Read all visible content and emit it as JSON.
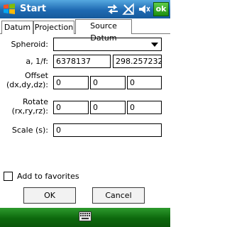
{
  "titlebar": {
    "title": "Start",
    "ok_label": "ok",
    "icons": [
      "windows-logo",
      "sync-arrows-icon",
      "signal-off-icon",
      "volume-icon"
    ]
  },
  "tabs": [
    {
      "label": "Datum",
      "active": false
    },
    {
      "label": "Projection",
      "active": false
    },
    {
      "label": "Source Datum",
      "active": true
    }
  ],
  "form": {
    "spheroid_label": "Spheroid:",
    "spheroid_value": "",
    "af_label": "a, 1/f:",
    "a_value": "6378137",
    "f_value": "298.257232",
    "offset_label_1": "Offset",
    "offset_label_2": "(dx,dy,dz):",
    "offset_values": [
      "0",
      "0",
      "0"
    ],
    "rotate_label_1": "Rotate",
    "rotate_label_2": "(rx,ry,rz):",
    "rotate_values": [
      "0",
      "0",
      "0"
    ],
    "scale_label": "Scale (s):",
    "scale_value": "0"
  },
  "favorites": {
    "label": "Add to favorites",
    "checked": false
  },
  "buttons": {
    "ok": "OK",
    "cancel": "Cancel"
  },
  "softbar": {
    "icon": "keyboard-icon"
  },
  "colors": {
    "titlebar": "#1f6ab2",
    "softbar": "#0d680d",
    "ok_button": "#1c8e10"
  }
}
